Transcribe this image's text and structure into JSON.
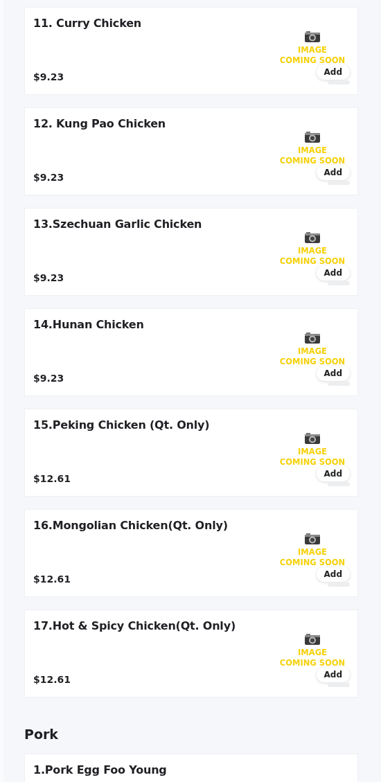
{
  "sections": [
    {
      "items": [
        {
          "name": "11. Curry Chicken",
          "price": "$9.23",
          "image_text": [
            "IMAGE",
            "COMING SOON"
          ],
          "button": "Add"
        },
        {
          "name": "12. Kung Pao Chicken",
          "price": "$9.23",
          "image_text": [
            "IMAGE",
            "COMING SOON"
          ],
          "button": "Add"
        },
        {
          "name": "13.Szechuan Garlic Chicken",
          "price": "$9.23",
          "image_text": [
            "IMAGE",
            "COMING SOON"
          ],
          "button": "Add"
        },
        {
          "name": "14.Hunan Chicken",
          "price": "$9.23",
          "image_text": [
            "IMAGE",
            "COMING SOON"
          ],
          "button": "Add"
        },
        {
          "name": "15.Peking Chicken (Qt. Only)",
          "price": "$12.61",
          "image_text": [
            "IMAGE",
            "COMING SOON"
          ],
          "button": "Add"
        },
        {
          "name": "16.Mongolian Chicken(Qt. Only)",
          "price": "$12.61",
          "image_text": [
            "IMAGE",
            "COMING SOON"
          ],
          "button": "Add"
        },
        {
          "name": "17.Hot & Spicy Chicken(Qt. Only)",
          "price": "$12.61",
          "image_text": [
            "IMAGE",
            "COMING SOON"
          ],
          "button": "Add"
        }
      ]
    },
    {
      "title": "Pork",
      "items": [
        {
          "name": "1.Pork Egg Foo Young"
        }
      ]
    }
  ]
}
